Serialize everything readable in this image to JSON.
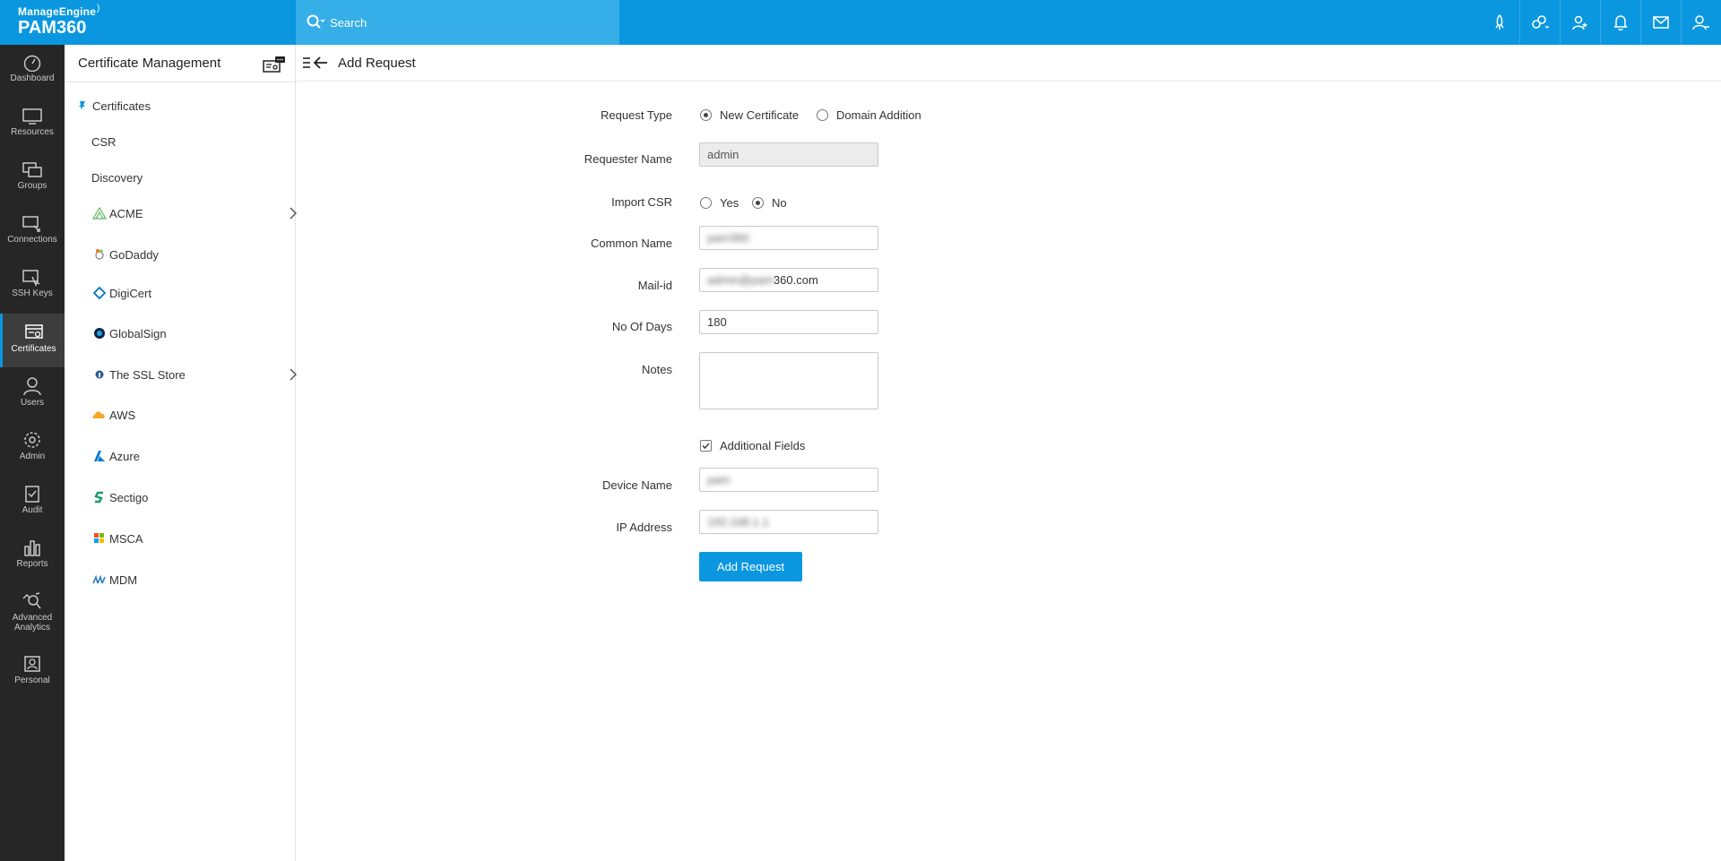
{
  "brand": {
    "company": "ManageEngine",
    "product": "PAM360"
  },
  "search": {
    "placeholder": "Search"
  },
  "top_icons": [
    "rocket-icon",
    "link-key-icon",
    "user-star-icon",
    "bell-icon",
    "mail-icon",
    "user-settings-icon"
  ],
  "leftnav": {
    "items": [
      {
        "label": "Dashboard",
        "icon": "dashboard-icon"
      },
      {
        "label": "Resources",
        "icon": "monitor-icon"
      },
      {
        "label": "Groups",
        "icon": "groups-icon"
      },
      {
        "label": "Connections",
        "icon": "connections-icon"
      },
      {
        "label": "SSH Keys",
        "icon": "ssh-key-icon"
      },
      {
        "label": "Certificates",
        "icon": "certificate-icon",
        "active": true
      },
      {
        "label": "Users",
        "icon": "user-icon"
      },
      {
        "label": "Admin",
        "icon": "gear-icon"
      },
      {
        "label": "Audit",
        "icon": "clipboard-check-icon"
      },
      {
        "label": "Reports",
        "icon": "bar-chart-icon"
      },
      {
        "label": "Advanced",
        "label2": "Analytics",
        "icon": "analytics-icon"
      },
      {
        "label": "Personal",
        "icon": "personal-icon"
      }
    ]
  },
  "subnav": {
    "title": "Certificate Management",
    "items": [
      {
        "label": "Certificates",
        "icon": "pin-icon"
      },
      {
        "label": "CSR"
      },
      {
        "label": "Discovery"
      },
      {
        "label": "ACME",
        "icon": "acme-icon",
        "has_children": true
      },
      {
        "label": "GoDaddy",
        "icon": "godaddy-icon"
      },
      {
        "label": "DigiCert",
        "icon": "digicert-icon"
      },
      {
        "label": "GlobalSign",
        "icon": "globalsign-icon"
      },
      {
        "label": "The SSL Store",
        "icon": "sslstore-icon",
        "has_children": true
      },
      {
        "label": "AWS",
        "icon": "aws-icon"
      },
      {
        "label": "Azure",
        "icon": "azure-icon"
      },
      {
        "label": "Sectigo",
        "icon": "sectigo-icon"
      },
      {
        "label": "MSCA",
        "icon": "msca-icon"
      },
      {
        "label": "MDM",
        "icon": "mdm-icon"
      }
    ]
  },
  "page": {
    "title": "Add Request"
  },
  "form": {
    "request_type": {
      "label": "Request Type",
      "options": [
        "New Certificate",
        "Domain Addition"
      ],
      "selected": "New Certificate"
    },
    "requester_name": {
      "label": "Requester Name",
      "value": "admin"
    },
    "import_csr": {
      "label": "Import CSR",
      "options": [
        "Yes",
        "No"
      ],
      "selected": "No"
    },
    "common_name": {
      "label": "Common Name",
      "value": "pam360"
    },
    "mail_id": {
      "label": "Mail-id",
      "value_hidden": "admin@pam",
      "value_visible": "360.com"
    },
    "no_of_days": {
      "label": "No Of Days",
      "value": "180"
    },
    "notes": {
      "label": "Notes",
      "value": ""
    },
    "additional_fields": {
      "label": "Additional Fields",
      "checked": true
    },
    "device_name": {
      "label": "Device Name",
      "value": "pam"
    },
    "ip_address": {
      "label": "IP Address",
      "value": "192.168.1.1"
    },
    "submit_label": "Add Request"
  },
  "colors": {
    "accent": "#0a97e0",
    "nav_bg": "#262626"
  }
}
